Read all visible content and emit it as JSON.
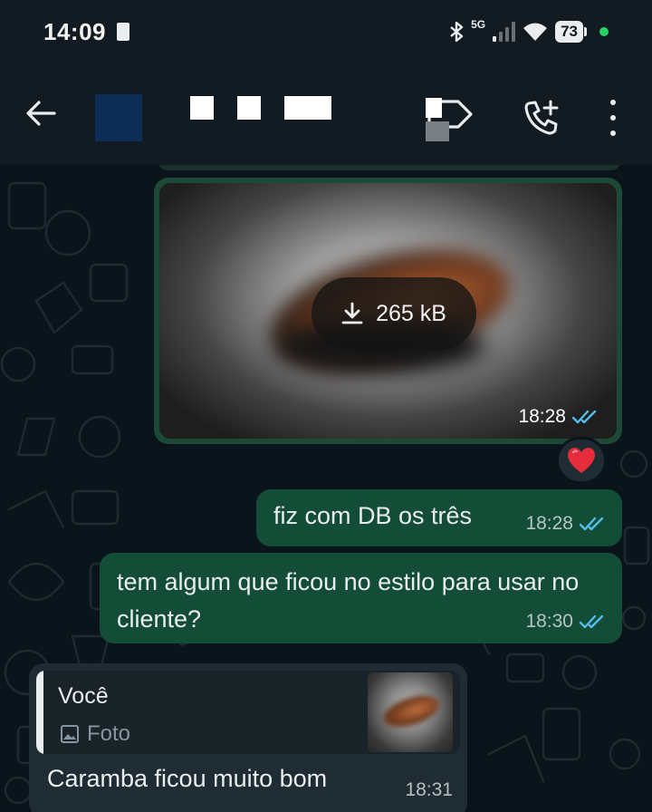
{
  "status_bar": {
    "time": "14:09",
    "network": "5G",
    "battery": "73"
  },
  "header": {
    "back_icon": "arrow-left",
    "avatar_color": "#0c2d55",
    "label_icon": "label-tag",
    "call_icon": "phone-add",
    "more_icon": "more-vertical"
  },
  "messages": {
    "image": {
      "download_size": "265 kB",
      "time": "18:28",
      "status_icon": "double-check-read",
      "reaction": "❤️"
    },
    "text1": {
      "text": "fiz com DB os três",
      "time": "18:28"
    },
    "text2": {
      "text": "tem algum que ficou no estilo para usar no cliente?",
      "time": "18:30"
    },
    "reply": {
      "quote_author": "Você",
      "quote_type": "Foto",
      "text": "Caramba ficou muito bom",
      "time": "18:31"
    }
  },
  "colors": {
    "header_bg": "#111b21",
    "chat_bg": "#0b141a",
    "outgoing_bubble": "#144d37",
    "incoming_bubble": "#1f2c33",
    "read_ticks": "#53bdeb",
    "online_dot": "#25d366"
  }
}
